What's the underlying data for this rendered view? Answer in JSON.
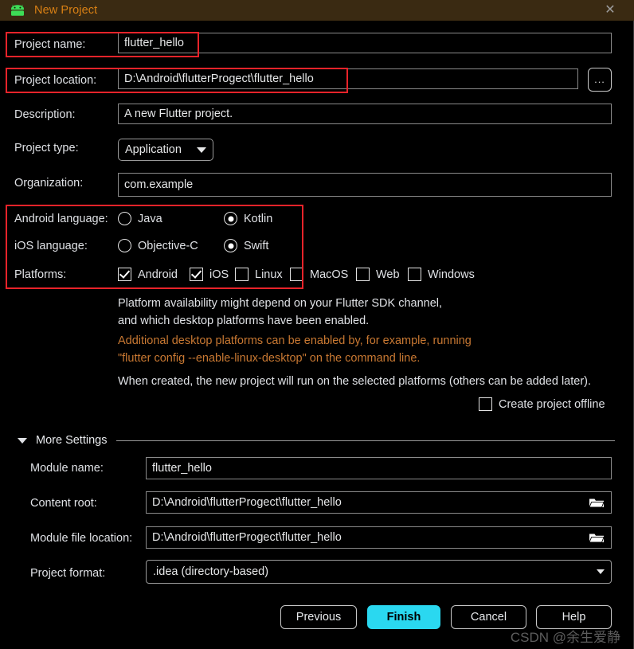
{
  "window": {
    "title": "New Project",
    "icon": "android-robot-icon",
    "close_label": "✕",
    "titlebar_color": "#3a2a12",
    "title_color": "#d98014",
    "android_green": "#3ddc57"
  },
  "form": {
    "project_name": {
      "label": "Project name:",
      "value": "flutter_hello"
    },
    "project_location": {
      "label": "Project location:",
      "value": "D:\\Android\\flutterProgect\\flutter_hello",
      "browse_label": "..."
    },
    "description": {
      "label": "Description:",
      "value": "A new Flutter project."
    },
    "project_type": {
      "label": "Project type:",
      "value": "Application"
    },
    "organization": {
      "label": "Organization:",
      "value": "com.example"
    },
    "android_language": {
      "label": "Android language:",
      "options": [
        {
          "label": "Java",
          "selected": false
        },
        {
          "label": "Kotlin",
          "selected": true
        }
      ]
    },
    "ios_language": {
      "label": "iOS language:",
      "options": [
        {
          "label": "Objective-C",
          "selected": false
        },
        {
          "label": "Swift",
          "selected": true
        }
      ]
    },
    "platforms": {
      "label": "Platforms:",
      "options": [
        {
          "label": "Android",
          "checked": true
        },
        {
          "label": "iOS",
          "checked": true
        },
        {
          "label": "Linux",
          "checked": false
        },
        {
          "label": "MacOS",
          "checked": false
        },
        {
          "label": "Web",
          "checked": false
        },
        {
          "label": "Windows",
          "checked": false
        }
      ]
    },
    "offline": {
      "label": "Create project offline",
      "checked": false
    }
  },
  "info": {
    "line1": "Platform availability might depend on your Flutter SDK channel,",
    "line2": "and which desktop platforms have been enabled.",
    "warn1": "Additional desktop platforms can be enabled by, for example, running",
    "warn2": "\"flutter config --enable-linux-desktop\" on the command line.",
    "line3": "When created, the new project will run on the selected platforms (others can be added later).",
    "warn_color": "#c87832"
  },
  "more_settings": {
    "title": "More Settings",
    "expanded": true,
    "module_name": {
      "label": "Module name:",
      "value": "flutter_hello"
    },
    "content_root": {
      "label": "Content root:",
      "value": "D:\\Android\\flutterProgect\\flutter_hello",
      "icon": "folder-icon"
    },
    "module_file_location": {
      "label": "Module file location:",
      "value": "D:\\Android\\flutterProgect\\flutter_hello",
      "icon": "folder-icon"
    },
    "project_format": {
      "label": "Project format:",
      "value": ".idea (directory-based)"
    }
  },
  "buttons": {
    "previous": "Previous",
    "finish": "Finish",
    "cancel": "Cancel",
    "help": "Help",
    "finish_color": "#2ad8f0"
  },
  "watermark": "CSDN @余生爱静"
}
